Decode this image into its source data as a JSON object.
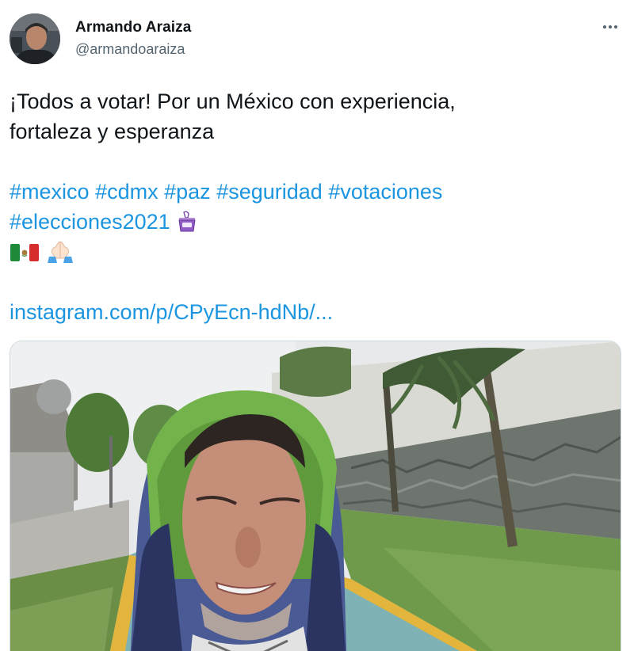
{
  "author": {
    "name": "Armando Araiza",
    "handle": "@armandoaraiza"
  },
  "tweet": {
    "text_line1": "¡Todos a votar! Por un México con experiencia,",
    "text_line2": "fortaleza y esperanza",
    "hashtags_line1": [
      "#mexico",
      "#cdmx",
      "#paz",
      "#seguridad",
      "#votaciones"
    ],
    "hashtags_line2": [
      "#elecciones2021"
    ],
    "link": "instagram.com/p/CPyEcn-hdNb/..."
  },
  "icons": {
    "more": "more-options-icon",
    "ballot": "ballot-box-icon",
    "flag": "mexico-flag-icon",
    "hands": "folded-hands-icon"
  },
  "colors": {
    "link": "#1b95e0",
    "text": "#0f1419",
    "secondary": "#536471"
  }
}
